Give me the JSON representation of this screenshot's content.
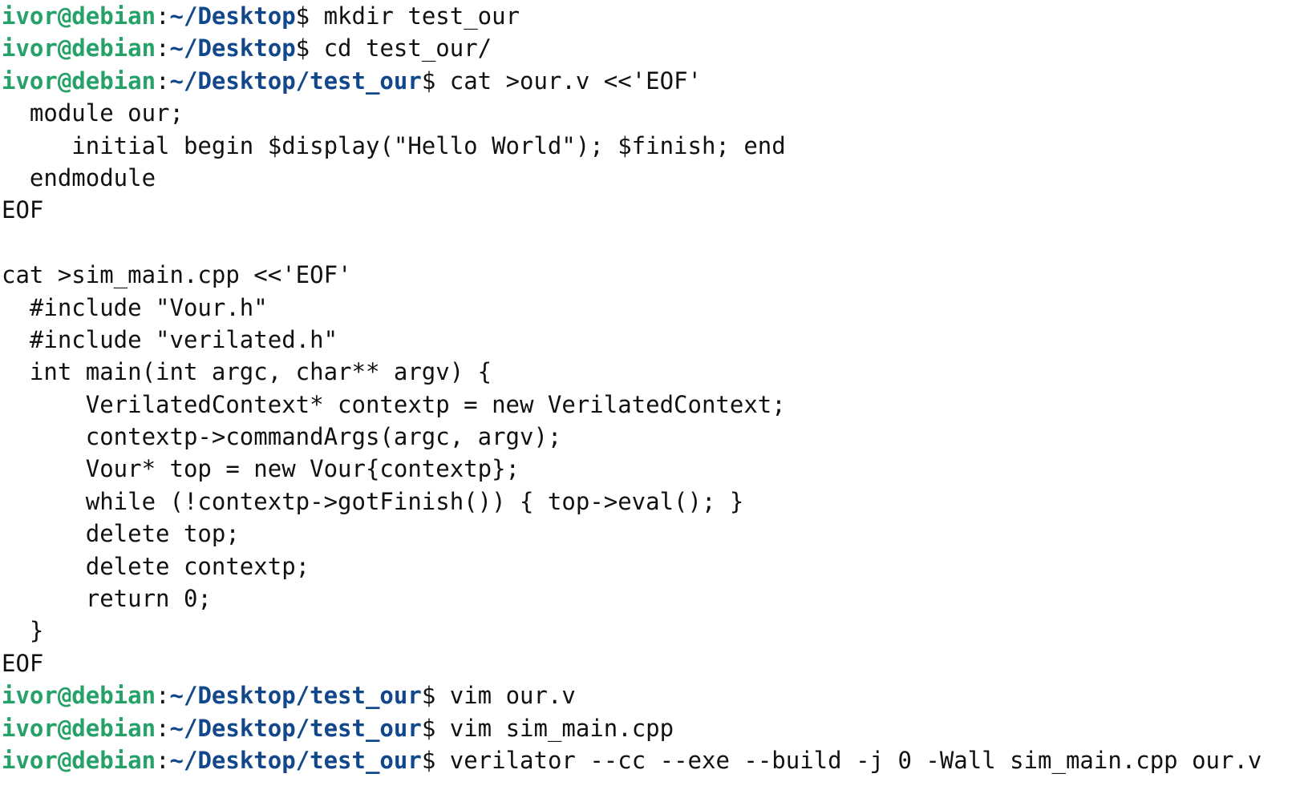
{
  "terminal": {
    "colors": {
      "background": "#ffffff",
      "text": "#111111",
      "user": "#26a269",
      "path": "#12488b"
    },
    "lines": [
      {
        "type": "prompt",
        "user": "ivor@debian",
        "colon": ":",
        "path": "~/Desktop",
        "dollar": "$",
        "cmd": " mkdir test_our"
      },
      {
        "type": "prompt",
        "user": "ivor@debian",
        "colon": ":",
        "path": "~/Desktop",
        "dollar": "$",
        "cmd": " cd test_our/"
      },
      {
        "type": "prompt",
        "user": "ivor@debian",
        "colon": ":",
        "path": "~/Desktop/test_our",
        "dollar": "$",
        "cmd": " cat >our.v <<'EOF'"
      },
      {
        "type": "text",
        "text": "  module our;"
      },
      {
        "type": "text",
        "text": "     initial begin $display(\"Hello World\"); $finish; end"
      },
      {
        "type": "text",
        "text": "  endmodule"
      },
      {
        "type": "text",
        "text": "EOF"
      },
      {
        "type": "text",
        "text": ""
      },
      {
        "type": "text",
        "text": "cat >sim_main.cpp <<'EOF'"
      },
      {
        "type": "text",
        "text": "  #include \"Vour.h\""
      },
      {
        "type": "text",
        "text": "  #include \"verilated.h\""
      },
      {
        "type": "text",
        "text": "  int main(int argc, char** argv) {"
      },
      {
        "type": "text",
        "text": "      VerilatedContext* contextp = new VerilatedContext;"
      },
      {
        "type": "text",
        "text": "      contextp->commandArgs(argc, argv);"
      },
      {
        "type": "text",
        "text": "      Vour* top = new Vour{contextp};"
      },
      {
        "type": "text",
        "text": "      while (!contextp->gotFinish()) { top->eval(); }"
      },
      {
        "type": "text",
        "text": "      delete top;"
      },
      {
        "type": "text",
        "text": "      delete contextp;"
      },
      {
        "type": "text",
        "text": "      return 0;"
      },
      {
        "type": "text",
        "text": "  }"
      },
      {
        "type": "text",
        "text": "EOF"
      },
      {
        "type": "prompt",
        "user": "ivor@debian",
        "colon": ":",
        "path": "~/Desktop/test_our",
        "dollar": "$",
        "cmd": " vim our.v"
      },
      {
        "type": "prompt",
        "user": "ivor@debian",
        "colon": ":",
        "path": "~/Desktop/test_our",
        "dollar": "$",
        "cmd": " vim sim_main.cpp"
      },
      {
        "type": "prompt",
        "user": "ivor@debian",
        "colon": ":",
        "path": "~/Desktop/test_our",
        "dollar": "$",
        "cmd": " verilator --cc --exe --build -j 0 -Wall sim_main.cpp our.v"
      }
    ]
  }
}
